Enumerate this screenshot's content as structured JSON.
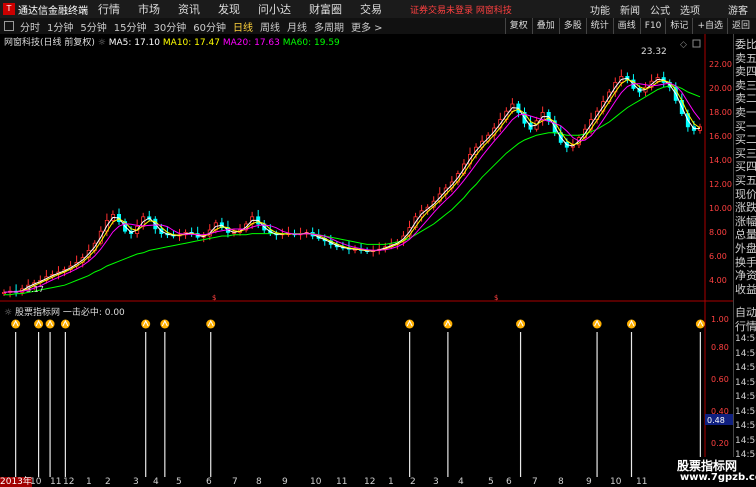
{
  "menubar": {
    "app_title": "通达信金融终端",
    "items": [
      "行情",
      "市场",
      "资讯",
      "发现",
      "问小达",
      "财富圈",
      "交易"
    ],
    "warning": "证券交易未登录  网窗科技",
    "right": [
      "功能",
      "新闻",
      "公式",
      "选项"
    ],
    "guest": "游客"
  },
  "toolbar": {
    "periods": [
      "分时",
      "1分钟",
      "5分钟",
      "15分钟",
      "30分钟",
      "60分钟",
      "日线",
      "周线",
      "月线",
      "多周期",
      "更多 >"
    ],
    "active_period": "日线",
    "right_buttons": [
      "复权",
      "叠加",
      "多股",
      "统计",
      "画线",
      "F10",
      "标记",
      "+自选",
      "返回"
    ]
  },
  "main_chart": {
    "title": "网窗科技(日线 前复权)",
    "ma5": "MA5: 17.10",
    "ma10": "MA10: 17.47",
    "ma20": "MA20: 17.63",
    "ma60": "MA60: 19.59",
    "colors": {
      "ma5": "#ffffff",
      "ma10": "#ffff00",
      "ma20": "#ff00ff",
      "ma60": "#00ff00",
      "up": "#ff3030",
      "down": "#00ffff"
    },
    "y_ticks": [
      "22.00",
      "20.00",
      "18.00",
      "16.00",
      "14.00",
      "12.00",
      "10.00",
      "8.00",
      "6.00",
      "4.00"
    ],
    "high_label": "23.32",
    "low_label": "3.17"
  },
  "indicator": {
    "title": "股票指标网",
    "signal_label": "一击必中: 0.00",
    "y_ticks": [
      "1.00",
      "0.80",
      "0.60",
      "0.40",
      "0.20"
    ],
    "current_value": "0.48"
  },
  "x_axis": {
    "labels": [
      "2013年",
      "10",
      "11",
      "12",
      "1",
      "2",
      "3",
      "4",
      "5",
      "6",
      "7",
      "8",
      "9",
      "10",
      "11",
      "12",
      "1",
      "2",
      "3",
      "4",
      "5",
      "6",
      "7",
      "8",
      "9",
      "10",
      "11"
    ]
  },
  "right_panel": {
    "labels": [
      "委比",
      "卖五",
      "卖四",
      "卖三",
      "卖二",
      "卖一",
      "买一",
      "买二",
      "买三",
      "买四",
      "买五",
      "现价",
      "涨跌",
      "涨幅",
      "总量",
      "外盘",
      "换手",
      "净资",
      "收益"
    ],
    "bottom_labels": [
      "自动",
      "行情"
    ],
    "times": [
      "14:56",
      "14:56",
      "14:56",
      "14:56",
      "14:56",
      "14:56",
      "14:56",
      "14:56",
      "14:56"
    ]
  },
  "watermark": {
    "line1": "股票指标网",
    "line2": "www.7gpzb.com"
  },
  "chart_data": {
    "type": "line",
    "title": "",
    "unit": "",
    "xlabel": "",
    "ylabel": "",
    "ylim": [
      3,
      24
    ],
    "close": [
      3.3,
      3.4,
      3.3,
      3.6,
      3.9,
      4.1,
      4.3,
      4.6,
      4.8,
      5.0,
      5.2,
      5.5,
      5.8,
      6.2,
      6.8,
      7.4,
      8.4,
      9.3,
      9.8,
      9.2,
      8.4,
      8.2,
      8.8,
      9.6,
      9.4,
      8.6,
      8.2,
      8.1,
      8.0,
      8.1,
      8.3,
      8.2,
      7.9,
      8.0,
      8.5,
      9.1,
      8.7,
      8.3,
      8.3,
      8.5,
      9.0,
      9.6,
      9.0,
      8.5,
      8.2,
      8.1,
      8.2,
      8.2,
      8.1,
      8.2,
      8.3,
      8.0,
      7.8,
      7.6,
      7.3,
      7.1,
      7.0,
      6.9,
      6.9,
      6.8,
      6.7,
      6.8,
      6.9,
      7.1,
      7.3,
      7.5,
      8.0,
      8.7,
      9.6,
      10.1,
      10.4,
      10.9,
      11.5,
      12.0,
      12.5,
      13.2,
      14.0,
      14.8,
      15.4,
      15.9,
      16.4,
      17.0,
      17.7,
      18.4,
      19.0,
      18.3,
      17.4,
      16.9,
      17.6,
      18.3,
      17.6,
      16.6,
      15.8,
      15.4,
      15.6,
      16.2,
      16.9,
      17.7,
      18.4,
      19.2,
      20.0,
      20.8,
      21.3,
      21.0,
      20.3,
      20.0,
      20.4,
      20.9,
      21.2,
      20.8,
      20.4,
      19.3,
      18.2,
      17.1,
      16.8,
      17.1
    ],
    "ma60": [
      3.1,
      3.1,
      3.2,
      3.2,
      3.3,
      3.4,
      3.5,
      3.6,
      3.7,
      3.8,
      3.9,
      4.1,
      4.3,
      4.5,
      4.7,
      5.0,
      5.2,
      5.5,
      5.7,
      5.9,
      6.1,
      6.3,
      6.5,
      6.6,
      6.8,
      6.9,
      7.0,
      7.1,
      7.2,
      7.3,
      7.4,
      7.5,
      7.6,
      7.7,
      7.8,
      7.9,
      8.0,
      8.0,
      8.1,
      8.1,
      8.1,
      8.2,
      8.2,
      8.2,
      8.2,
      8.2,
      8.2,
      8.2,
      8.2,
      8.2,
      8.2,
      8.2,
      8.1,
      8.0,
      7.9,
      7.8,
      7.7,
      7.6,
      7.5,
      7.4,
      7.3,
      7.3,
      7.3,
      7.3,
      7.4,
      7.5,
      7.6,
      7.8,
      8.1,
      8.4,
      8.7,
      9.0,
      9.4,
      9.8,
      10.2,
      10.7,
      11.2,
      11.8,
      12.3,
      12.9,
      13.4,
      13.9,
      14.4,
      14.9,
      15.3,
      15.7,
      16.0,
      16.2,
      16.4,
      16.5,
      16.6,
      16.6,
      16.5,
      16.4,
      16.4,
      16.4,
      16.5,
      16.7,
      16.9,
      17.2,
      17.5,
      17.9,
      18.3,
      18.7,
      19.0,
      19.3,
      19.6,
      19.9,
      20.2,
      20.4,
      20.5,
      20.5,
      20.3,
      20.0,
      19.8,
      19.6
    ],
    "signals_x": [
      2,
      8,
      11,
      15,
      36,
      41,
      53,
      105,
      115,
      134,
      154,
      163,
      181
    ]
  }
}
